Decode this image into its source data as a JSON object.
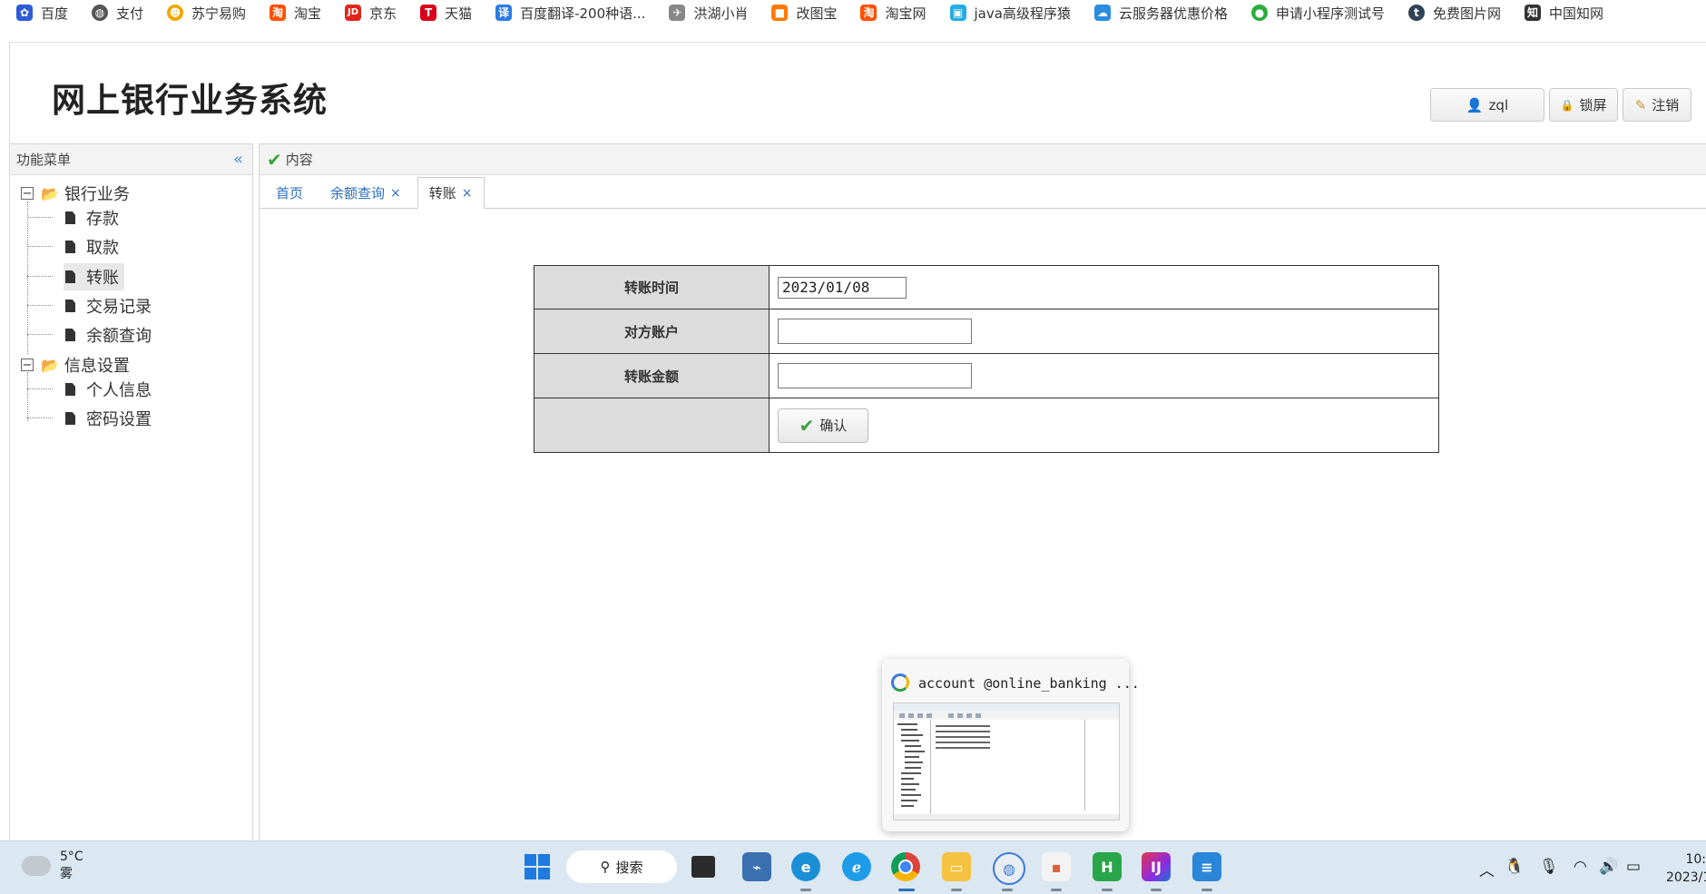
{
  "bookmarks": [
    {
      "label": "百度",
      "icon": "baidu-paw-icon",
      "color": "#2f5bd6"
    },
    {
      "label": "支付",
      "icon": "globe-icon",
      "color": "#555555"
    },
    {
      "label": "苏宁易购",
      "icon": "suning-lion-icon",
      "color": "#f2a600"
    },
    {
      "label": "淘宝",
      "icon": "taobao-icon",
      "color": "#ff5000"
    },
    {
      "label": "京东",
      "icon": "jd-icon",
      "color": "#e1251b"
    },
    {
      "label": "天猫",
      "icon": "tmall-icon",
      "color": "#d8001b"
    },
    {
      "label": "百度翻译-200种语...",
      "icon": "translate-icon",
      "color": "#2a7be4"
    },
    {
      "label": "洪湖小肖",
      "icon": "bird-icon",
      "color": "#666666"
    },
    {
      "label": "改图宝",
      "icon": "gaitubao-icon",
      "color": "#ff7a00"
    },
    {
      "label": "淘宝网",
      "icon": "taobao-icon",
      "color": "#ff5000"
    },
    {
      "label": "java高级程序猿",
      "icon": "bilibili-icon",
      "color": "#23ade5"
    },
    {
      "label": "云服务器优惠价格",
      "icon": "cloud-icon",
      "color": "#2a8de0"
    },
    {
      "label": "申请小程序测试号",
      "icon": "wechat-icon",
      "color": "#2bad3c"
    },
    {
      "label": "免费图片网",
      "icon": "tumblr-icon",
      "color": "#2f4356"
    },
    {
      "label": "中国知网",
      "icon": "cnki-icon",
      "color": "#333333"
    }
  ],
  "header": {
    "title": "网上银行业务系统",
    "user_label": "zql",
    "lock_label": "锁屏",
    "logout_label": "注销"
  },
  "sidebar": {
    "title": "功能菜单",
    "groups": [
      {
        "label": "银行业务",
        "items": [
          "存款",
          "取款",
          "转账",
          "交易记录",
          "余额查询"
        ],
        "selected": "转账"
      },
      {
        "label": "信息设置",
        "items": [
          "个人信息",
          "密码设置"
        ]
      }
    ]
  },
  "content": {
    "panel_title": "内容",
    "tabs": [
      {
        "label": "首页",
        "closable": false,
        "active": false
      },
      {
        "label": "余额查询",
        "closable": true,
        "active": false
      },
      {
        "label": "转账",
        "closable": true,
        "active": true
      }
    ],
    "close_glyph": "×"
  },
  "form": {
    "rows": [
      {
        "label": "转账时间",
        "value": "2023/01/08",
        "placeholder": ""
      },
      {
        "label": "对方账户",
        "value": "",
        "placeholder": ""
      },
      {
        "label": "转账金额",
        "value": "",
        "placeholder": ""
      }
    ],
    "confirm_label": "确认"
  },
  "thumbnail_popup": {
    "title": "account @online_banking ..."
  },
  "taskbar": {
    "weather_temp": "5°C",
    "weather_desc": "雾",
    "search_label": "搜索",
    "clock_time": "10:",
    "clock_date": "2023/1"
  },
  "colors": {
    "accent_link": "#2a6ebb",
    "check_green": "#3aa13a",
    "label_bg": "#dcdcdc",
    "taskbar_bg": "#dbe7f1"
  }
}
